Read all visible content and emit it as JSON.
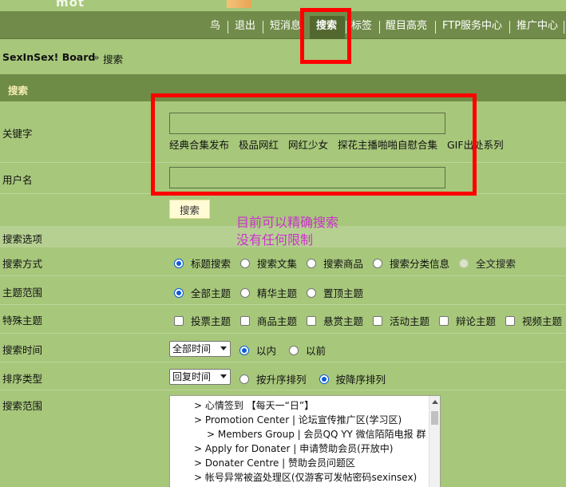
{
  "top": {
    "logo_fragment": "mot"
  },
  "nav": {
    "items": [
      {
        "label": "鸟"
      },
      {
        "label": "退出"
      },
      {
        "label": "短消息"
      },
      {
        "label": "搜索"
      },
      {
        "label": "标签"
      },
      {
        "label": "醒目高亮"
      },
      {
        "label": "FTP服务中心"
      },
      {
        "label": "推广中心"
      }
    ],
    "active": "搜索"
  },
  "breadcrumb": {
    "home": "SexInSex! Board",
    "separator": "»",
    "current": "搜索"
  },
  "section": {
    "title": "搜索"
  },
  "form": {
    "keyword_label": "关键字",
    "keyword_value": "",
    "hot_keywords": [
      "经典合集发布",
      "极品网红",
      "网红少女",
      "探花主播啪啪自慰合集",
      "GIF出处系列"
    ],
    "username_label": "用户名",
    "username_value": "",
    "submit_label": "搜索"
  },
  "annotation": {
    "line1": "目前可以精确搜索",
    "line2": "没有任何限制"
  },
  "options": {
    "header": "搜索选项",
    "method": {
      "label": "搜索方式",
      "choices": [
        {
          "text": "标题搜索",
          "checked": true
        },
        {
          "text": "搜索文集",
          "checked": false
        },
        {
          "text": "搜索商品",
          "checked": false
        },
        {
          "text": "搜索分类信息",
          "checked": false
        },
        {
          "text": "全文搜索",
          "checked": false,
          "disabled": true
        }
      ]
    },
    "scope": {
      "label": "主题范围",
      "choices": [
        {
          "text": "全部主题",
          "checked": true
        },
        {
          "text": "精华主题",
          "checked": false
        },
        {
          "text": "置顶主题",
          "checked": false
        }
      ]
    },
    "special": {
      "label": "特殊主题",
      "choices": [
        "投票主题",
        "商品主题",
        "悬赏主题",
        "活动主题",
        "辩论主题",
        "视频主题"
      ]
    },
    "time": {
      "label": "搜索时间",
      "select_value": "全部时间",
      "choices": [
        {
          "text": "以内",
          "checked": true
        },
        {
          "text": "以前",
          "checked": false
        }
      ]
    },
    "order": {
      "label": "排序类型",
      "select_value": "回复时间",
      "choices": [
        {
          "text": "按升序排列",
          "checked": false
        },
        {
          "text": "按降序排列",
          "checked": true
        }
      ]
    },
    "range": {
      "label": "搜索范围",
      "forums": [
        "> 心情签到 【每天一“日”】",
        "> Promotion Center | 论坛宣传推广区(学习区)",
        "> Members Group | 会员QQ YY 微信陌陌电报 群",
        "> Apply for Donater | 申请赞助会员(开放中)",
        "> Donater Centre | 赞助会员问题区",
        "> 帐号异常被盗处理区(仅游客可发帖密码sexinsex)"
      ]
    }
  },
  "colors": {
    "page_bg": "#a7c77b",
    "nav_bg": "#718c4a",
    "header_bg": "#6f8c47",
    "annotation_red": "#ff0000",
    "note_magenta": "#cc33cc"
  }
}
